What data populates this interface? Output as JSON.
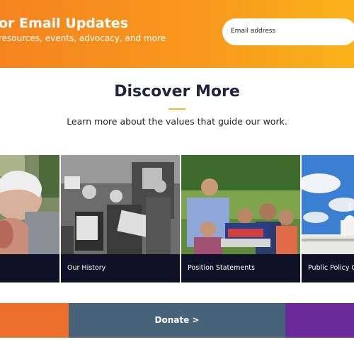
{
  "banner": {
    "title": "or Email Updates",
    "subtitle": "resources, events, advocacy, and more",
    "email_placeholder": "Email address"
  },
  "section": {
    "heading": "Discover More",
    "lead": "Learn more about the values that guide our work."
  },
  "cards": [
    {
      "label": ""
    },
    {
      "label": "Our History"
    },
    {
      "label": "Position Statements"
    },
    {
      "label": "Public Policy G"
    }
  ],
  "footer": {
    "donate_label": "Donate >"
  },
  "colors": {
    "banner_start": "#f5841f",
    "banner_end": "#f9b21a",
    "heading": "#1e2540",
    "accent_underline": "#f2b824",
    "caption_bg": "#0f1226",
    "donate_left": "#ec6f2b",
    "donate_mid": "#486277",
    "donate_right": "#6a2a9b"
  }
}
